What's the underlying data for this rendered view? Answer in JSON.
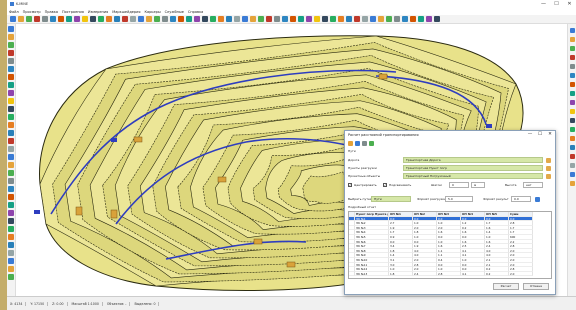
{
  "app": {
    "title": "K-MINE"
  },
  "window_controls": [
    "—",
    "☐",
    "✕"
  ],
  "menu": [
    "Файл",
    "Просмотр",
    "Правка",
    "Построения",
    "Измерения",
    "Маркшейдерия",
    "Карьеры",
    "Службные",
    "Справка"
  ],
  "toolbar_colors": [
    "#3a7bd5",
    "#e5a33a",
    "#4caf50",
    "#c0392b",
    "#7f8c8d",
    "#2e86c1",
    "#d35400",
    "#16a085",
    "#8e44ad",
    "#f1c40f",
    "#34495e",
    "#27ae60",
    "#e67e22",
    "#2980b9",
    "#c0392b",
    "#95a5a6",
    "#3a7bd5",
    "#e5a33a",
    "#4caf50",
    "#7f8c8d",
    "#2e86c1",
    "#d35400",
    "#16a085",
    "#8e44ad",
    "#34495e",
    "#27ae60",
    "#e67e22",
    "#2980b9",
    "#95a5a6",
    "#3a7bd5",
    "#e5a33a",
    "#4caf50",
    "#c0392b",
    "#7f8c8d",
    "#2e86c1",
    "#d35400",
    "#16a085",
    "#8e44ad",
    "#f1c40f",
    "#34495e",
    "#27ae60",
    "#e67e22",
    "#2980b9",
    "#c0392b",
    "#95a5a6",
    "#3a7bd5",
    "#e5a33a",
    "#4caf50",
    "#7f8c8d",
    "#2e86c1",
    "#d35400",
    "#16a085",
    "#8e44ad",
    "#34495e"
  ],
  "colors": {
    "pit_fill": "#e8e28a",
    "contour": "#2b2b10",
    "road": "#2e3dbf",
    "accent_green": "#d6e7a8"
  },
  "statusbar": [
    "X: 4134",
    "Y: 17150",
    "Z: 0.00",
    "Масштаб 1:1000",
    "Объектов: -",
    "Выделено: 0"
  ],
  "dialog": {
    "title": "Расчет расстояний транспортирования",
    "window_controls": [
      "—",
      "☐",
      "✕"
    ],
    "section_label": "Пути",
    "fields": [
      {
        "label": "Дорога",
        "value": "Транспортная Дорога"
      },
      {
        "label": "Пункты разгрузки",
        "value": "Транспортная Пункт погр"
      },
      {
        "label": "Проектные объекты",
        "value": "Транспортный Погрузочный"
      }
    ],
    "check_center": "Центрировать",
    "check_show": "Подсвечивать",
    "step_label": "Шагом",
    "step_value": "0",
    "step_unit": "м",
    "height_label": "Высота",
    "height_value": "нет",
    "sort_label": "Выбрать путем",
    "sort_value": "Пути",
    "load_format_label": "Формат разгрузки",
    "load_format_value": "5.0",
    "result_format_label": "Формат результ",
    "result_format_value": "0.0",
    "tab_label": "Подробный отчет",
    "table": {
      "headers": [
        "",
        "Пункт погр Пункта разгрузки",
        "ОП №1",
        "ОП №2",
        "ОП №3",
        "ОП №4",
        "ОП №5",
        "Сумм"
      ],
      "rows": [
        [
          "",
          "ЭК №1",
          "0.0",
          "0.0",
          "0.0",
          "0.0",
          "0.0",
          "0.0"
        ],
        [
          "",
          "ЭК №2",
          "2.7",
          "1.0",
          "1.0",
          "1.2",
          "1.7",
          "2.8"
        ],
        [
          "",
          "ЭК №3",
          "1.9",
          "2.0",
          "2.0",
          "0.2",
          "1.6",
          "1.7"
        ],
        [
          "",
          "ЭК №4",
          "1.7",
          "1.8",
          "1.6",
          "1.6",
          "1.4",
          "1.7"
        ],
        [
          "",
          "ЭК №5",
          "0.9",
          "1.0",
          "0.0",
          "0.0",
          "1.0",
          "600"
        ],
        [
          "",
          "ЭК №6",
          "0.0",
          "0.0",
          "1.0",
          "1.6",
          "1.6",
          "2.2"
        ],
        [
          "",
          "ЭК №7",
          "3.4",
          "1.9",
          "1.6",
          "2.5",
          "2.4",
          "2.8"
        ],
        [
          "",
          "ЭК №8",
          "1.8",
          "4.0",
          "1.1",
          "4.1",
          "4.0",
          "2.0"
        ],
        [
          "",
          "ЭК №9",
          "1.4",
          "4.0",
          "1.1",
          "4.1",
          "4.0",
          "2.0"
        ],
        [
          "",
          "ЭК №10",
          "3.1",
          "2.0",
          "0.4",
          "1.0",
          "2.1",
          "2.0"
        ],
        [
          "",
          "ЭК №11",
          "3.0",
          "2.8",
          "0.0",
          "0.0",
          "2.1",
          "2.0"
        ],
        [
          "",
          "ЭК №12",
          "1.0",
          "2.0",
          "1.0",
          "0.0",
          "0.2",
          "2.8"
        ],
        [
          "",
          "ЭК №13",
          "1.8",
          "2.4",
          "2.8",
          "4.1",
          "0.2",
          "2.0"
        ]
      ]
    },
    "ok_label": "Расчет",
    "cancel_label": "Отмена"
  }
}
